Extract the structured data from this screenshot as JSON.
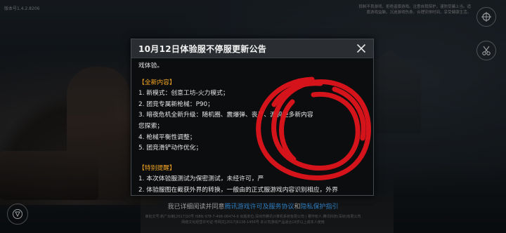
{
  "background": {
    "version_label": "版本号1.4.2.8206",
    "top_notice": "抵制不良游戏，拒绝盗版游戏。注意自我保护，谨防受骗上当。适度游戏益脑，沉迷游戏伤身。合理安排时间，享受健康生活。"
  },
  "agreement": {
    "prefix": "我已详细阅读并同意",
    "link1": "腾讯游戏许可及服务协议",
    "middle": "和",
    "link2": "隐私保护指引"
  },
  "footer": {
    "line1": "审批文号:新广出审[2017]10号 ISBN 978-7-498-06474-9 出版单位:深圳市腾讯计算机系统有限公司 | 著作权人:腾讯科技(深圳)有限公司",
    "line2": "网络文化经营许可证:粤网文[2017]6138-1456号 本公司游戏产品适合18岁以上成年人使用"
  },
  "dialog": {
    "title": "10月12日体验服不停服更新公告",
    "lines": [
      "戏体验。",
      "【全新内容】",
      "1. 新模式：创意工坊-火力模式；",
      "2. 团竞专属新枪械：P90；",
      "3. 暗夜危机全新升级：随机圈、震爆弹、丧尸、渡鸦更多新内容",
      "您探索；",
      "4. 枪械平衡性调整；",
      "5. 团竞滑铲动作优化；",
      "【特别提醒】",
      "1. 本次体验服测试为保密测试，未经许可，严",
      "2. 体验服图在截获外界的转换，一般由的正式服游戏内容识别相应，外界"
    ]
  },
  "colors": {
    "accent_orange": "#f5a623",
    "link_blue": "#3fa7ff",
    "scribble_red": "#e0141b"
  },
  "icons": {
    "close": "close-icon",
    "side_top_right": "crosshair-icon",
    "side_right": "scissors-icon",
    "side_bottom_left": "game-logo-icon"
  }
}
